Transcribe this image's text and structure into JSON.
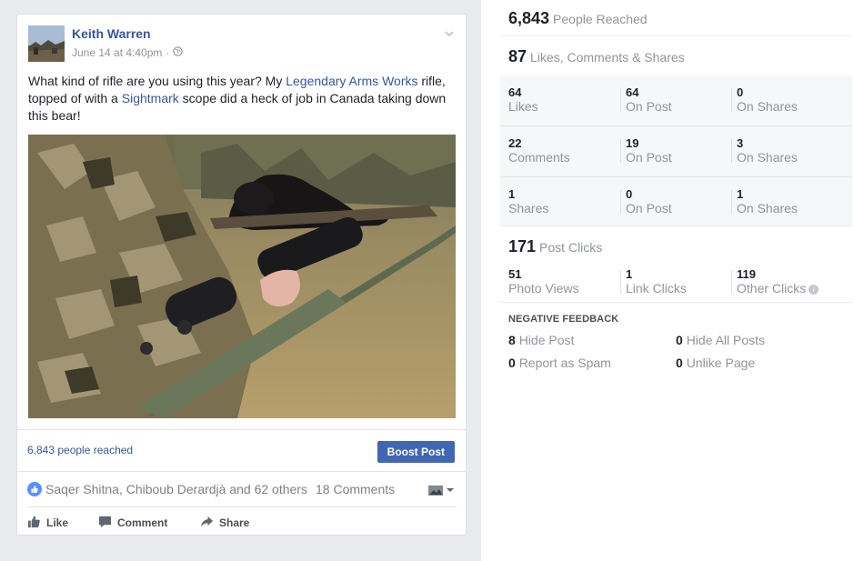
{
  "post": {
    "author": "Keith Warren",
    "timestamp": "June 14 at 4:40pm",
    "separator": "·",
    "text_parts": [
      "What kind of rifle are you using this year? My ",
      "Legendary Arms Works",
      " rifle, topped of with a ",
      "Sightmark",
      " scope did a heck of job in Canada taking down this bear!"
    ],
    "reach_text": "6,843 people reached",
    "boost_label": "Boost Post",
    "reactors": "Saqer Shitna, Chiboub Derardjà and 62 others",
    "comments_count": "18 Comments",
    "actions": {
      "like": "Like",
      "comment": "Comment",
      "share": "Share"
    },
    "icons": [
      "globe-icon",
      "chevron-down-icon",
      "like-reaction-icon",
      "thumbs-up-icon",
      "comment-icon",
      "share-icon"
    ]
  },
  "stats": {
    "reached": {
      "num": "6,843",
      "label": "People Reached"
    },
    "engagement": {
      "num": "87",
      "label": "Likes, Comments & Shares"
    },
    "rows": [
      {
        "cells": [
          {
            "v": "64",
            "l": "Likes"
          },
          {
            "v": "64",
            "l": "On Post"
          },
          {
            "v": "0",
            "l": "On Shares"
          }
        ]
      },
      {
        "cells": [
          {
            "v": "22",
            "l": "Comments"
          },
          {
            "v": "19",
            "l": "On Post"
          },
          {
            "v": "3",
            "l": "On Shares"
          }
        ]
      },
      {
        "cells": [
          {
            "v": "1",
            "l": "Shares"
          },
          {
            "v": "0",
            "l": "On Post"
          },
          {
            "v": "1",
            "l": "On Shares"
          }
        ]
      }
    ],
    "clicks": {
      "num": "171",
      "label": "Post Clicks",
      "cells": [
        {
          "v": "51",
          "l": "Photo Views"
        },
        {
          "v": "1",
          "l": "Link Clicks"
        },
        {
          "v": "119",
          "l": "Other Clicks"
        }
      ],
      "info_glyph": "i"
    },
    "negative": {
      "title": "NEGATIVE FEEDBACK",
      "items": [
        {
          "v": "8",
          "l": "Hide Post"
        },
        {
          "v": "0",
          "l": "Hide All Posts"
        },
        {
          "v": "0",
          "l": "Report as Spam"
        },
        {
          "v": "0",
          "l": "Unlike Page"
        }
      ]
    }
  },
  "colors": {
    "link": "#365899",
    "boost": "#4267b2",
    "muted": "#90949c",
    "reaction": "#5890ff"
  }
}
